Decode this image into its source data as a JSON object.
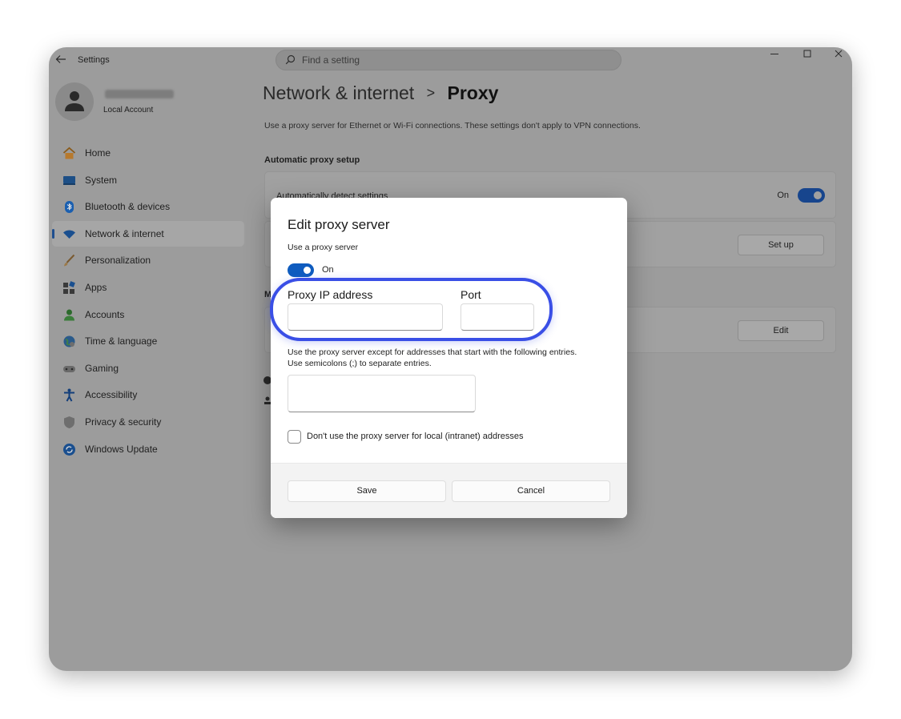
{
  "app": {
    "title": "Settings"
  },
  "search": {
    "placeholder": "Find a setting"
  },
  "window_controls": {
    "minimize": "minimize",
    "maximize": "maximize",
    "close": "close"
  },
  "profile": {
    "account_type": "Local Account"
  },
  "sidebar": {
    "items": [
      {
        "label": "Home",
        "icon": "home-icon"
      },
      {
        "label": "System",
        "icon": "system-icon"
      },
      {
        "label": "Bluetooth & devices",
        "icon": "bluetooth-icon"
      },
      {
        "label": "Network & internet",
        "icon": "wifi-icon",
        "selected": true
      },
      {
        "label": "Personalization",
        "icon": "brush-icon"
      },
      {
        "label": "Apps",
        "icon": "apps-icon"
      },
      {
        "label": "Accounts",
        "icon": "person-icon"
      },
      {
        "label": "Time & language",
        "icon": "globe-icon"
      },
      {
        "label": "Gaming",
        "icon": "gamepad-icon"
      },
      {
        "label": "Accessibility",
        "icon": "accessibility-icon"
      },
      {
        "label": "Privacy & security",
        "icon": "shield-icon"
      },
      {
        "label": "Windows Update",
        "icon": "update-icon"
      }
    ]
  },
  "header": {
    "breadcrumb_parent": "Network & internet",
    "separator": ">",
    "breadcrumb_current": "Proxy",
    "description": "Use a proxy server for Ethernet or Wi-Fi connections. These settings don't apply to VPN connections."
  },
  "automatic": {
    "section_title": "Automatic proxy setup",
    "detect_label": "Automatically detect settings",
    "detect_state": "On",
    "setup_button": "Set up"
  },
  "manual": {
    "section_letter": "M",
    "edit_button": "Edit"
  },
  "dialog": {
    "title": "Edit proxy server",
    "use_proxy_label": "Use a proxy server",
    "use_proxy_state": "On",
    "ip_label": "Proxy IP address",
    "ip_value": "",
    "port_label": "Port",
    "port_value": "",
    "exceptions_line1": "Use the proxy server except for addresses that start with the following entries.",
    "exceptions_line2": "Use semicolons (;) to separate entries.",
    "exceptions_value": "",
    "local_checkbox_label": "Don't use the proxy server for local (intranet) addresses",
    "local_checkbox_checked": false,
    "save_button": "Save",
    "cancel_button": "Cancel"
  },
  "colors": {
    "accent": "#0f5cbf",
    "highlight": "#3a4fe6",
    "dim_overlay": "#9c9c9c"
  }
}
